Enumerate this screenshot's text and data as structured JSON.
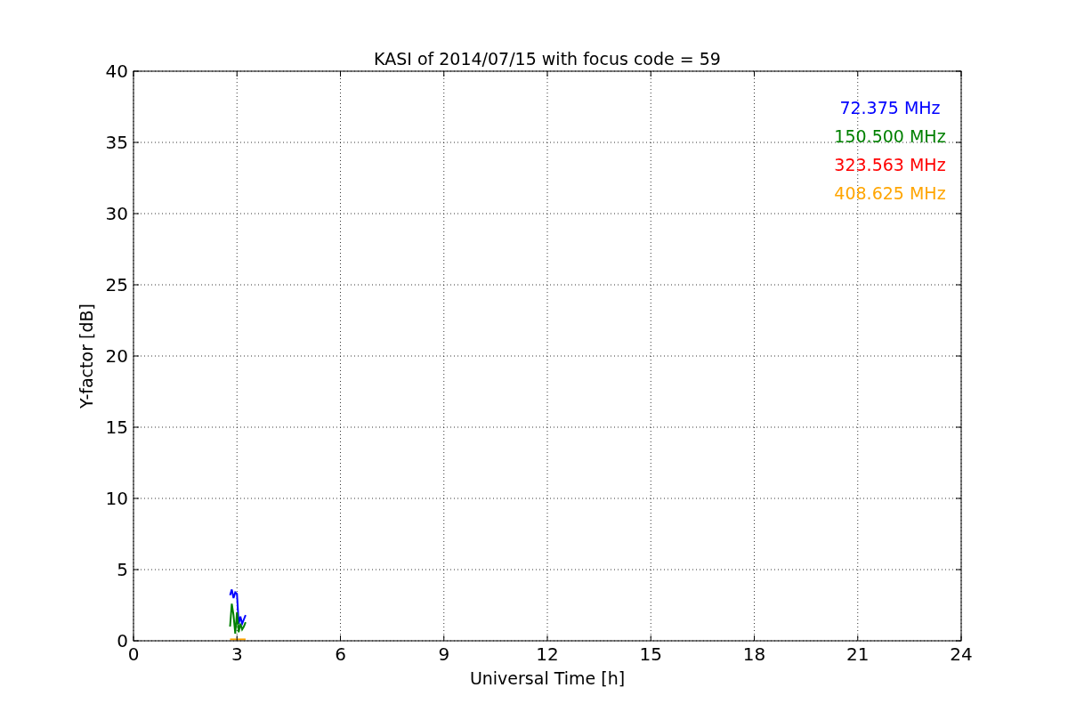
{
  "figure": {
    "chart_data": {
      "type": "line",
      "title": "KASI of 2014/07/15 with focus code = 59",
      "xlabel": "Universal Time [h]",
      "ylabel": "Y-factor [dB]",
      "x": [
        2.8,
        2.85,
        2.9,
        2.95,
        3.0,
        3.05,
        3.1,
        3.15,
        3.2,
        3.25
      ],
      "series": [
        {
          "name": "72.375 MHz",
          "color": "#0000ff",
          "values": [
            3.2,
            3.6,
            3.0,
            3.4,
            3.3,
            1.2,
            1.7,
            1.2,
            1.5,
            1.8
          ]
        },
        {
          "name": "150.500 MHz",
          "color": "#008000",
          "values": [
            1.0,
            2.6,
            1.8,
            0.5,
            2.0,
            0.6,
            1.2,
            0.8,
            1.0,
            1.3
          ]
        },
        {
          "name": "323.563 MHz",
          "color": "#ff0000",
          "values": [
            null,
            null,
            null,
            null,
            null,
            null,
            null,
            null,
            null,
            null
          ]
        },
        {
          "name": "408.625 MHz",
          "color": "#ffa500",
          "values": [
            0.1,
            0.1,
            0.1,
            0.1,
            0.1,
            0.1,
            0.1,
            0.1,
            0.1,
            0.1
          ]
        }
      ],
      "grid": true,
      "xlim": [
        0,
        24
      ],
      "ylim": [
        0,
        40
      ],
      "xticks": [
        0,
        3,
        6,
        9,
        12,
        15,
        18,
        21,
        24
      ],
      "yticks": [
        0,
        5,
        10,
        15,
        20,
        25,
        30,
        35,
        40
      ]
    }
  }
}
